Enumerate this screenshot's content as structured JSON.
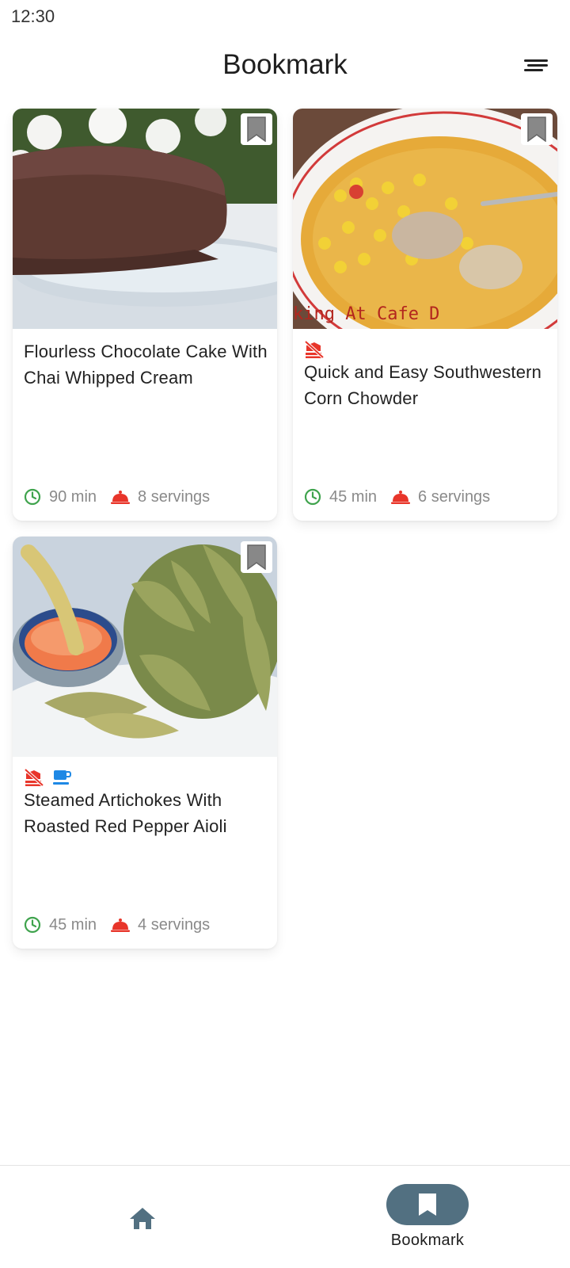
{
  "status_bar": {
    "time": "12:30"
  },
  "app_bar": {
    "title": "Bookmark",
    "sort_icon": "sort-lines-icon"
  },
  "recipes": [
    {
      "title": "Flourless Chocolate Cake With Chai Whipped Cream",
      "time": "90 min",
      "servings": "8 servings",
      "diet_icons": [],
      "bookmarked": true
    },
    {
      "title": "Quick and Easy Southwestern Corn Chowder",
      "time": "45 min",
      "servings": "6 servings",
      "diet_icons": [
        "no-dairy-icon"
      ],
      "image_text": "king At Cafe D",
      "bookmarked": true
    },
    {
      "title": "Steamed Artichokes With Roasted Red Pepper Aioli",
      "time": "45 min",
      "servings": "4 servings",
      "diet_icons": [
        "no-dairy-icon",
        "beverage-cup-icon"
      ],
      "bookmarked": true
    }
  ],
  "bottom_nav": {
    "items": [
      {
        "icon": "home-icon",
        "label": ""
      },
      {
        "icon": "bookmark-icon",
        "label": "Bookmark",
        "selected": true
      }
    ]
  },
  "colors": {
    "time_icon": "#3fa34d",
    "servings_icon": "#e8352a",
    "diet_red": "#e8352a",
    "diet_blue": "#1e88e5",
    "nav_accent": "#527081",
    "meta_text": "#8a8a8a"
  }
}
